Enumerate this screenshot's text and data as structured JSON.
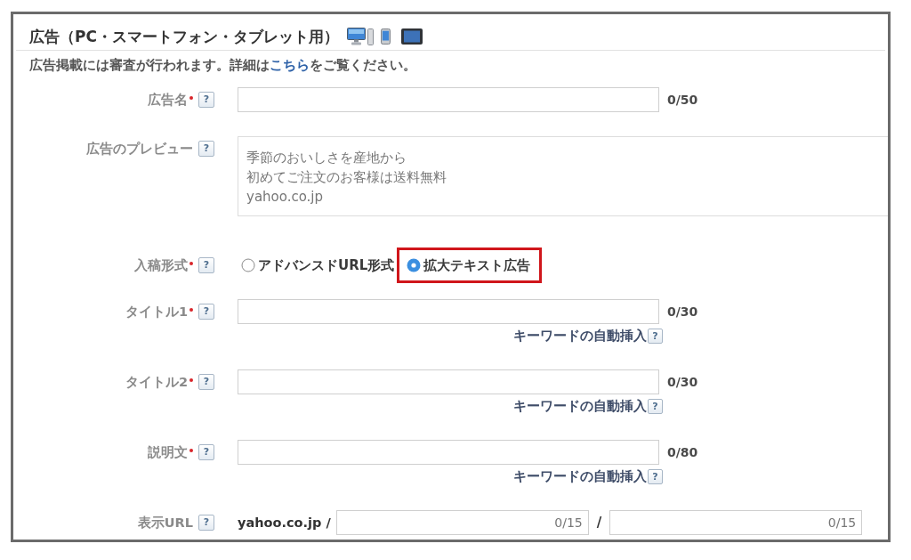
{
  "section": {
    "title": "広告（PC・スマートフォン・タブレット用）",
    "notice": {
      "before": "広告掲載には審査が行われます。詳細は",
      "link": "こちら",
      "after": "をご覧ください。"
    }
  },
  "fields": [
    {
      "kind": "text",
      "label": "広告名",
      "required": true,
      "help": "?",
      "counter": "0/50"
    },
    {
      "kind": "preview",
      "label": "広告のプレビュー",
      "required": false,
      "help": "?",
      "lines": [
        "季節のおいしさを産地から",
        "初めてご注文のお客様は送料無料",
        "yahoo.co.jp"
      ]
    },
    {
      "kind": "radio",
      "label": "入稿形式",
      "required": true,
      "help": "?",
      "options": [
        {
          "label": "アドバンスドURL形式",
          "selected": false,
          "highlighted": false
        },
        {
          "label": "拡大テキスト広告",
          "selected": true,
          "highlighted": true
        }
      ]
    },
    {
      "kind": "text",
      "label": "タイトル1",
      "required": true,
      "help": "?",
      "counter": "0/30",
      "keyword_link": {
        "label": "キーワードの自動挿入",
        "help": "?"
      }
    },
    {
      "kind": "text",
      "label": "タイトル2",
      "required": true,
      "help": "?",
      "counter": "0/30",
      "keyword_link": {
        "label": "キーワードの自動挿入",
        "help": "?"
      }
    },
    {
      "kind": "text",
      "label": "説明文",
      "required": true,
      "help": "?",
      "counter": "0/80",
      "keyword_link": {
        "label": "キーワードの自動挿入",
        "help": "?"
      }
    },
    {
      "kind": "url",
      "label": "表示URL",
      "required": false,
      "help": "?",
      "domain": "yahoo.co.jp /",
      "separator": "/",
      "paths": [
        {
          "counter": "0/15"
        },
        {
          "counter": "0/15"
        }
      ]
    }
  ]
}
